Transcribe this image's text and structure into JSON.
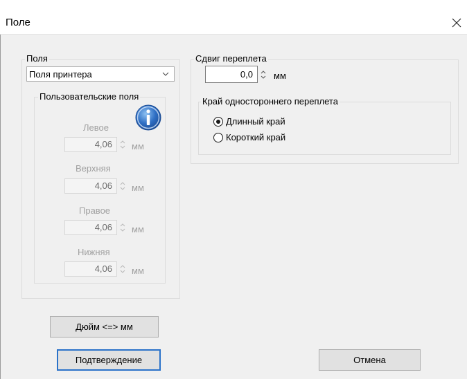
{
  "window": {
    "title": "Поле",
    "close_label": "✕"
  },
  "margins_group": {
    "label": "Поля",
    "dropdown_value": "Поля принтера"
  },
  "custom_margins": {
    "label": "Пользовательские поля",
    "left_label": "Левое",
    "left_value": "4,06",
    "top_label": "Верхняя",
    "top_value": "4,06",
    "right_label": "Правое",
    "right_value": "4,06",
    "bottom_label": "Нижняя",
    "bottom_value": "4,06",
    "unit": "мм"
  },
  "gutter": {
    "label": "Сдвиг переплета",
    "value": "0,0",
    "unit": "мм",
    "binding_edge_label": "Край одностороннего переплета",
    "long_edge_label": "Длинный край",
    "short_edge_label": "Короткий край",
    "selected": "long"
  },
  "buttons": {
    "convert_label": "Дюйм <=> мм",
    "confirm_label": "Подтверждение",
    "cancel_label": "Отмена"
  },
  "icons": {
    "info": "info-icon",
    "close": "close-icon",
    "dropdown": "chevron-down-icon",
    "spin": "spin-arrows-icon"
  },
  "colors": {
    "info_blue": "#2f6fc4",
    "default_button_border": "#2a72c9",
    "disabled_text": "#a0a0a0"
  }
}
